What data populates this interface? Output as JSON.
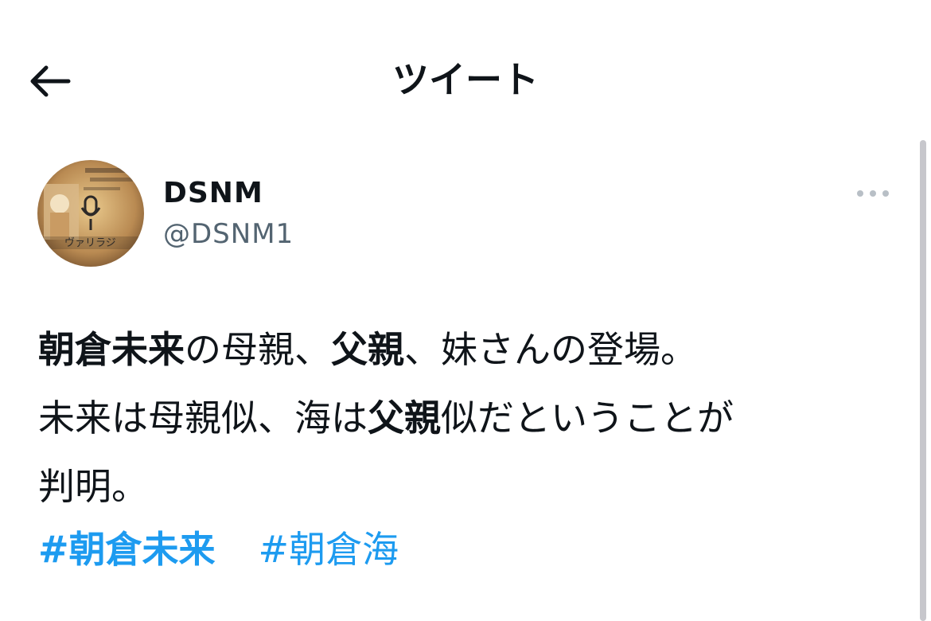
{
  "header": {
    "title": "ツイート",
    "back_icon": "arrow-left-icon"
  },
  "tweet": {
    "author": {
      "display_name": "DSNM",
      "handle": "@DSNM1",
      "avatar_text": "ヴァリラジ"
    },
    "more_icon": "ellipsis-icon",
    "text_segments": [
      {
        "text": "朝倉未来",
        "bold": true
      },
      {
        "text": "の母親、",
        "bold": false
      },
      {
        "text": "父親",
        "bold": true
      },
      {
        "text": "、妹さんの登場。",
        "bold": false
      },
      {
        "text": "未来は母親似、海は",
        "bold": false
      },
      {
        "text": "父親",
        "bold": true
      },
      {
        "text": "似だということが",
        "bold": false
      },
      {
        "text": "判明。",
        "bold": false
      }
    ],
    "hashtags": [
      {
        "text": "#朝倉未来",
        "bold": true
      },
      {
        "text": "#朝倉海",
        "bold": false
      }
    ]
  },
  "colors": {
    "text": "#0f1419",
    "secondary": "#536471",
    "link": "#1d9bf0"
  }
}
